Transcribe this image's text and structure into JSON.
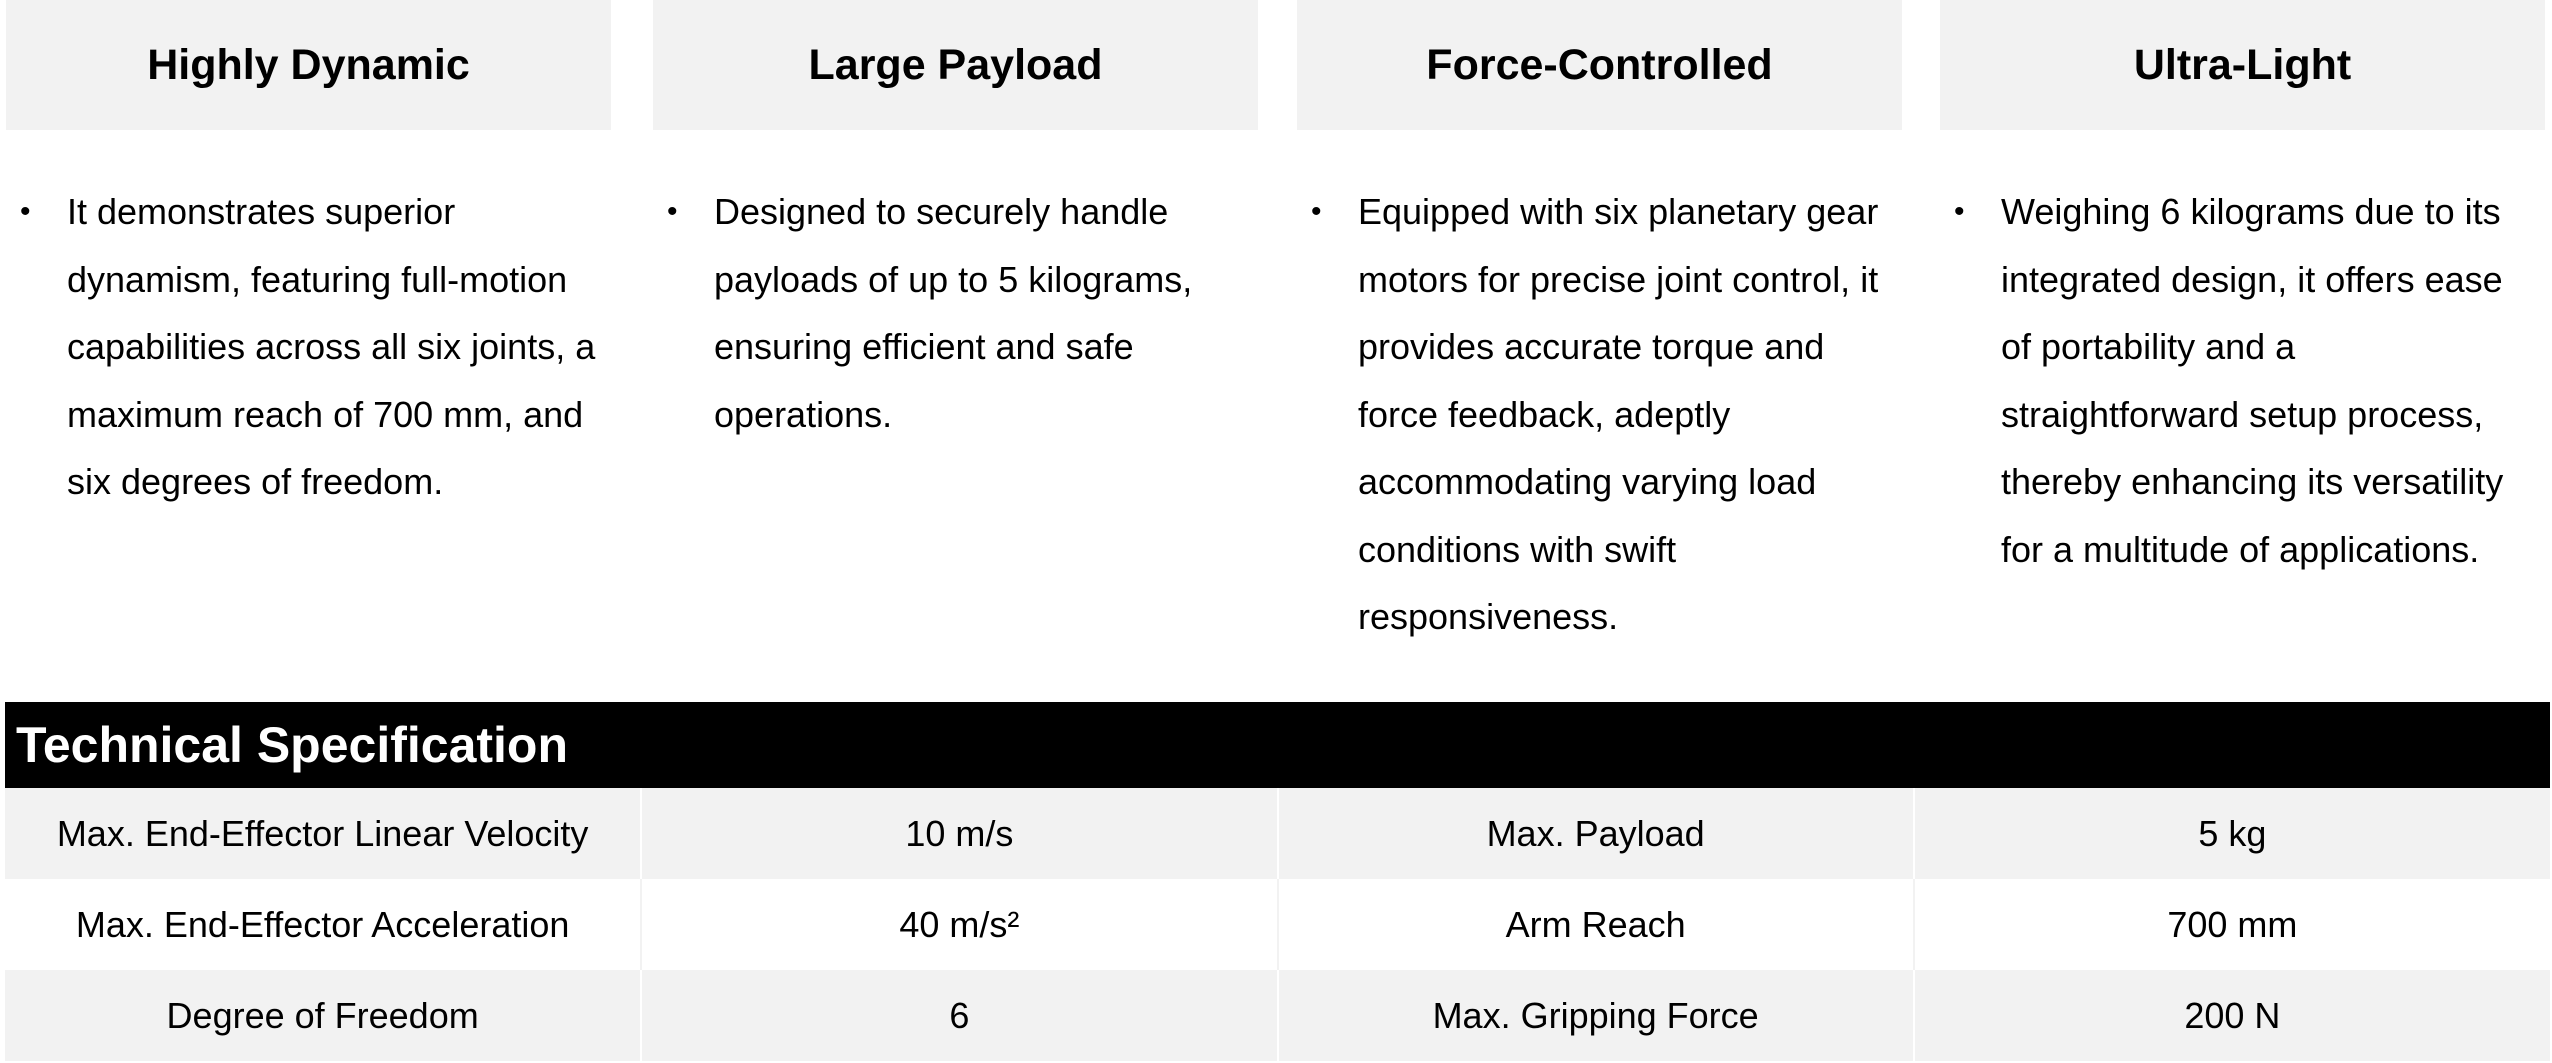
{
  "features": [
    {
      "title": "Highly Dynamic",
      "text": "It demonstrates superior dynamism, featuring full-motion capabilities across all six joints, a maximum reach of 700 mm, and six degrees of freedom."
    },
    {
      "title": "Large Payload",
      "text": "Designed to securely handle payloads of up to 5 kilograms, ensuring efficient and safe operations."
    },
    {
      "title": "Force-Controlled",
      "text": "Equipped with six planetary gear motors for precise joint control, it provides accurate torque and force feedback, adeptly accommodating varying load conditions with swift responsiveness."
    },
    {
      "title": "Ultra-Light",
      "text": "Weighing 6 kilograms due to its integrated design, it offers ease of portability and a straightforward setup process, thereby enhancing its versatility for a multitude of applications."
    }
  ],
  "bullet": "•",
  "spec": {
    "title": "Technical Specification",
    "rows": [
      [
        "Max. End-Effector Linear Velocity",
        "10 m/s",
        "Max. Payload",
        "5 kg"
      ],
      [
        "Max. End-Effector Acceleration",
        "40 m/s²",
        "Arm Reach",
        "700 mm"
      ],
      [
        "Degree of Freedom",
        "6",
        "Max. Gripping Force",
        "200 N"
      ]
    ]
  },
  "colors": {
    "header_bg": "#f2f2f2",
    "title_bar_bg": "#000000",
    "title_bar_text": "#ffffff"
  }
}
